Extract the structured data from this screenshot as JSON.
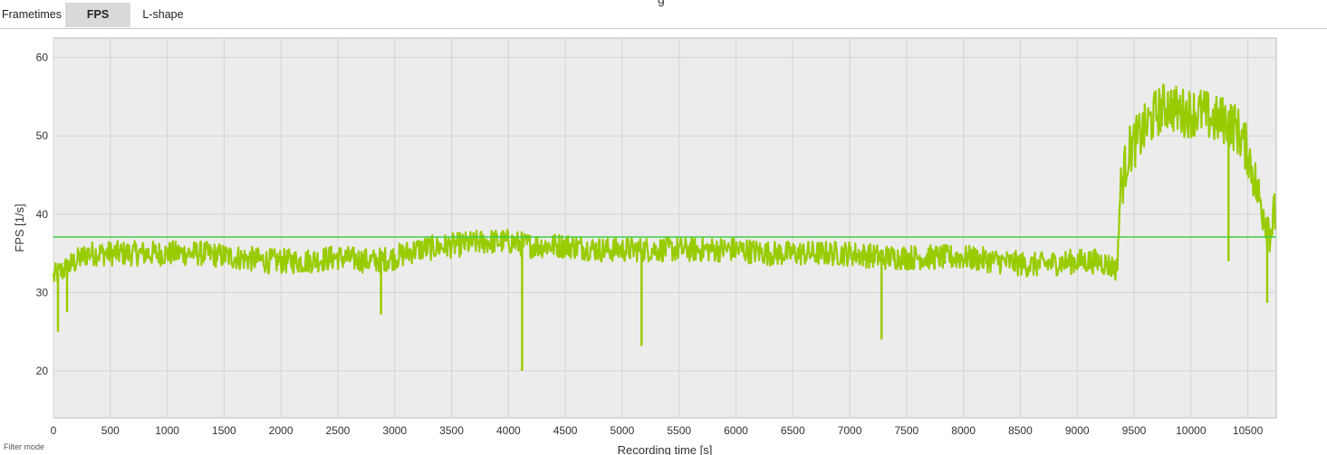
{
  "tabs": [
    {
      "label": "Frametimes",
      "active": false
    },
    {
      "label": "FPS",
      "active": true
    },
    {
      "label": "L-shape",
      "active": false
    }
  ],
  "top_title_fragment": "g",
  "footer": {
    "filter_mode_label": "Filter mode"
  },
  "colors": {
    "series": "#99cc00",
    "average_line": "#44cc44",
    "plot_background": "#ececec",
    "grid": "#d4d4d4"
  },
  "chart_data": {
    "type": "line",
    "title": "",
    "xlabel": "Recording time [s]",
    "ylabel": "FPS [1/s]",
    "xlim": [
      0,
      10750
    ],
    "ylim": [
      14,
      62.5
    ],
    "x_ticks": [
      0,
      500,
      1000,
      1500,
      2000,
      2500,
      3000,
      3500,
      4000,
      4500,
      5000,
      5500,
      6000,
      6500,
      7000,
      7500,
      8000,
      8500,
      9000,
      9500,
      10000,
      10500
    ],
    "y_ticks": [
      20,
      30,
      40,
      50,
      60
    ],
    "grid": true,
    "average_line": 37.1,
    "series": [
      {
        "x": [
          0,
          100,
          200,
          300,
          500,
          700,
          1000,
          1300,
          1600,
          1900,
          2200,
          2500,
          2800,
          3000,
          3200,
          3500,
          3800,
          4000,
          4200,
          4500,
          4800,
          5000,
          5300,
          5600,
          6000,
          6300,
          6600,
          7000,
          7300,
          7600,
          8000,
          8300,
          8600,
          9000,
          9200,
          9350,
          9380,
          9450,
          9550,
          9700,
          9800,
          9900,
          10000,
          10100,
          10200,
          10300,
          10400,
          10500,
          10600,
          10650,
          10700,
          10740
        ],
        "values": [
          32,
          33,
          34,
          35,
          35,
          35,
          35,
          35,
          34.5,
          34,
          34,
          34.5,
          34,
          34.5,
          35.5,
          36,
          36.5,
          36.5,
          36,
          36,
          35.5,
          35.5,
          35.5,
          35.5,
          35.5,
          35,
          35,
          35,
          34.5,
          34.5,
          34.5,
          34,
          33.5,
          34,
          34,
          33,
          43,
          48,
          50,
          53,
          54,
          53,
          53,
          53,
          52,
          52,
          51,
          48,
          42,
          40,
          38,
          40
        ]
      }
    ],
    "dips": [
      {
        "x": 40,
        "value": 25
      },
      {
        "x": 120,
        "value": 27.5
      },
      {
        "x": 2880,
        "value": 27.2
      },
      {
        "x": 4120,
        "value": 20
      },
      {
        "x": 5170,
        "value": 23.2
      },
      {
        "x": 7280,
        "value": 24
      },
      {
        "x": 10330,
        "value": 34
      },
      {
        "x": 10670,
        "value": 28.7
      }
    ]
  }
}
